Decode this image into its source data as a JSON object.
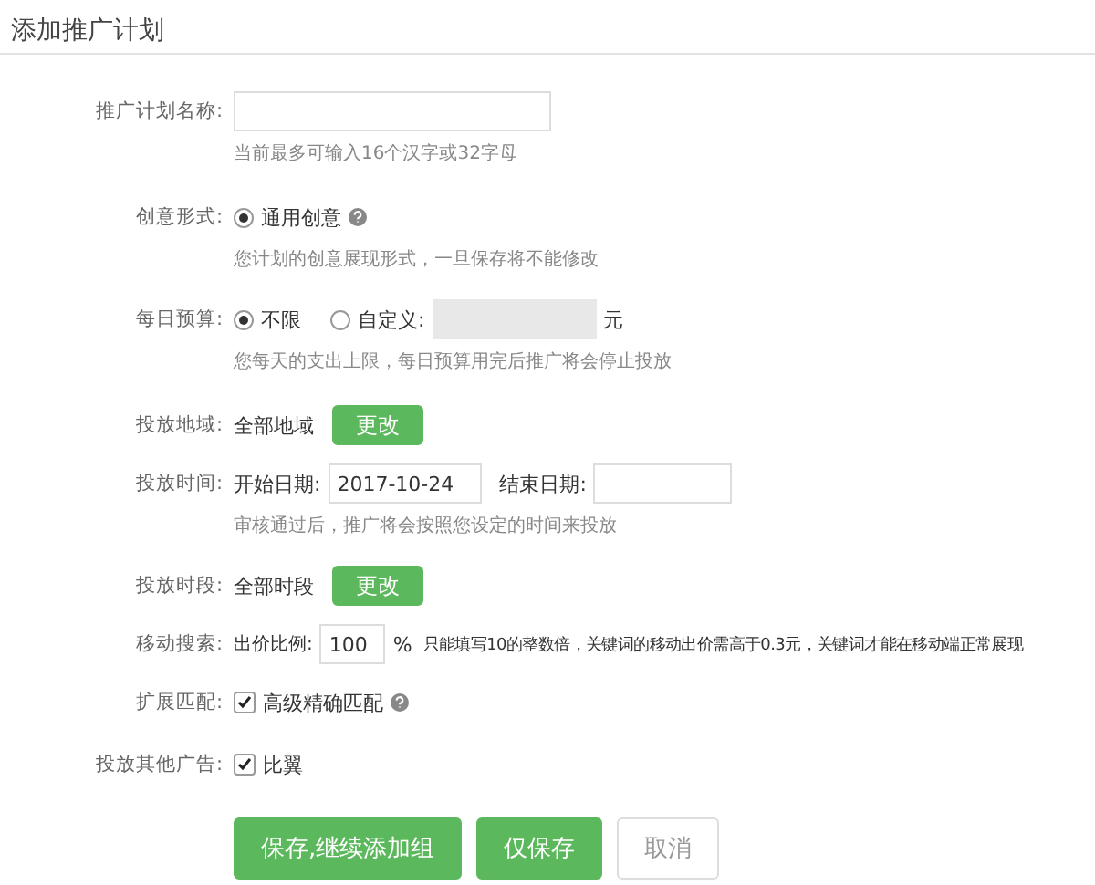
{
  "title": "添加推广计划",
  "fields": [
    {
      "kind": "text",
      "label": "推广计划名称:",
      "hint": "当前最多可输入16个汉字或32字母"
    },
    {
      "kind": "radio",
      "label": "创意形式:",
      "options": [
        {
          "label": "通用创意",
          "selected": true,
          "help": true
        }
      ],
      "hint": "您计划的创意展现形式，一旦保存将不能修改"
    },
    {
      "kind": "budget",
      "label": "每日预算:",
      "options": [
        {
          "label": "不限",
          "selected": true
        },
        {
          "label": "自定义:",
          "selected": false
        }
      ],
      "input_disabled": true,
      "unit": "元",
      "hint": "您每天的支出上限，每日预算用完后推广将会停止投放"
    },
    {
      "kind": "change",
      "label": "投放地域:",
      "value": "全部地域",
      "button": "更改"
    },
    {
      "kind": "dates",
      "label": "投放时间:",
      "start_label": "开始日期:",
      "start": "2017-10-24",
      "end_label": "结束日期:",
      "hint": "审核通过后，推广将会按照您设定的时间来投放"
    },
    {
      "kind": "change",
      "label": "投放时段:",
      "value": "全部时段",
      "button": "更改"
    },
    {
      "kind": "ratio",
      "label": "移动搜索:",
      "prefix": "出价比例:",
      "value": "100",
      "unit": "%",
      "note": "只能填写10的整数倍，关键词的移动出价需高于0.3元，关键词才能在移动端正常展现"
    },
    {
      "kind": "check",
      "label": "扩展匹配:",
      "options": [
        {
          "label": "高级精确匹配",
          "checked": true,
          "help": true
        }
      ]
    },
    {
      "kind": "check",
      "label": "投放其他广告:",
      "options": [
        {
          "label": "比翼",
          "checked": true,
          "help": false
        }
      ]
    }
  ],
  "buttons": [
    {
      "label": "保存,继续添加组",
      "primary": true
    },
    {
      "label": "仅保存",
      "primary": true
    },
    {
      "label": "取消",
      "primary": false
    }
  ]
}
